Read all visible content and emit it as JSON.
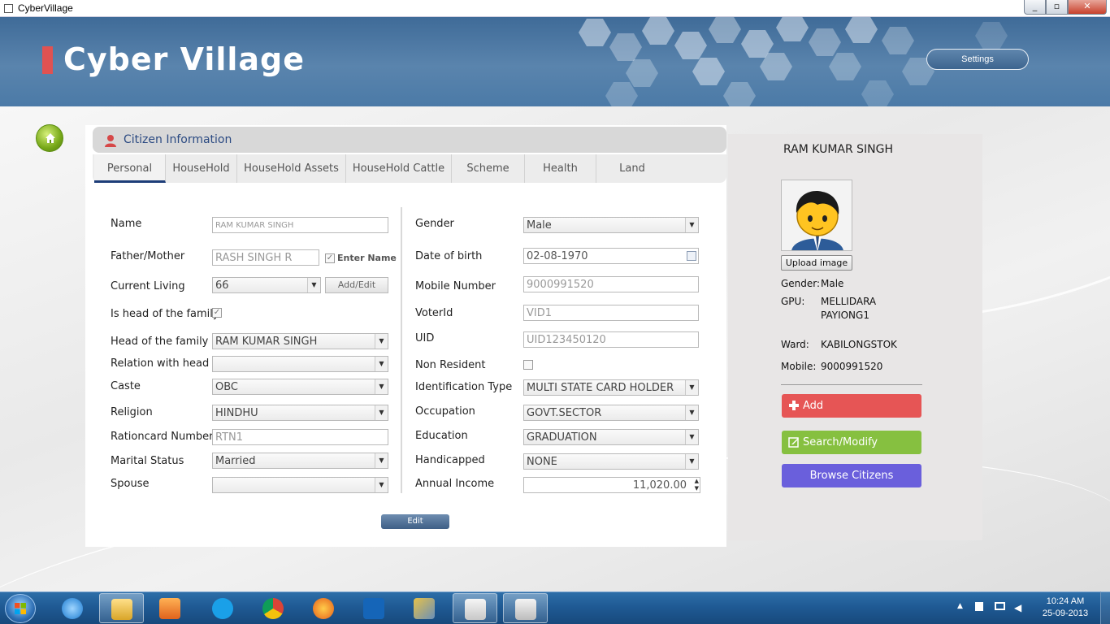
{
  "window": {
    "title": "CyberVillage"
  },
  "header": {
    "brand": "Cyber Village",
    "settings_label": "Settings"
  },
  "section": {
    "title": "Citizen Information"
  },
  "tabs": [
    {
      "label": "Personal",
      "active": true
    },
    {
      "label": "HouseHold"
    },
    {
      "label": "HouseHold Assets"
    },
    {
      "label": "HouseHold Cattle"
    },
    {
      "label": "Scheme"
    },
    {
      "label": "Health"
    },
    {
      "label": "Land"
    }
  ],
  "form_left": {
    "name": {
      "label": "Name",
      "value": "RAM KUMAR SINGH"
    },
    "father": {
      "label": "Father/Mother",
      "value": "RASH SINGH R",
      "enter_name_label": "Enter Name",
      "enter_name_checked": true
    },
    "current_living": {
      "label": "Current Living",
      "value": "66",
      "add_edit_label": "Add/Edit"
    },
    "is_head": {
      "label": "Is head of the family",
      "checked": true
    },
    "head": {
      "label": "Head of the family",
      "value": "RAM KUMAR SINGH"
    },
    "relation": {
      "label": "Relation with head",
      "value": ""
    },
    "caste": {
      "label": "Caste",
      "value": "OBC"
    },
    "religion": {
      "label": "Religion",
      "value": "HINDHU"
    },
    "rationcard": {
      "label": "Rationcard Number",
      "value": "RTN1"
    },
    "marital": {
      "label": "Marital Status",
      "value": "Married"
    },
    "spouse": {
      "label": "Spouse",
      "value": ""
    }
  },
  "form_right": {
    "gender": {
      "label": "Gender",
      "value": "Male"
    },
    "dob": {
      "label": "Date of birth",
      "value": "02-08-1970"
    },
    "mobile": {
      "label": "Mobile Number",
      "value": "9000991520"
    },
    "voter": {
      "label": "VoterId",
      "value": "VID1"
    },
    "uid": {
      "label": "UID",
      "value": "UID123450120"
    },
    "non_resident": {
      "label": "Non Resident",
      "checked": false
    },
    "id_type": {
      "label": "Identification Type",
      "value": "MULTI STATE CARD HOLDER"
    },
    "occupation": {
      "label": "Occupation",
      "value": "GOVT.SECTOR"
    },
    "education": {
      "label": "Education",
      "value": "GRADUATION"
    },
    "handicapped": {
      "label": "Handicapped",
      "value": "NONE"
    },
    "income": {
      "label": "Annual Income",
      "value": "11,020.00"
    }
  },
  "edit_label": "Edit",
  "side": {
    "name": "RAM KUMAR SINGH",
    "upload_label": "Upload image",
    "gender_label": "Gender:",
    "gender_value": "Male",
    "gpu_label": "GPU:",
    "gpu_value_1": "MELLIDARA",
    "gpu_value_2": "PAYIONG1",
    "ward_label": "Ward:",
    "ward_value": "KABILONGSTOK",
    "mobile_label": "Mobile:",
    "mobile_value": "9000991520",
    "add_label": "Add",
    "search_label": "Search/Modify",
    "browse_label": "Browse Citizens"
  },
  "taskbar": {
    "time": "10:24 AM",
    "date": "25-09-2013",
    "apps": [
      "explorer",
      "ie",
      "media-player",
      "skype",
      "chrome",
      "firefox",
      "maxthon",
      "tools",
      "calculator",
      "cybervillage"
    ]
  },
  "colors": {
    "header": "#4b7aa7",
    "accent_red": "#e05252",
    "add": "#e65555",
    "search": "#86c040",
    "browse": "#6a5fdc",
    "tab_active": "#1d3d78"
  }
}
